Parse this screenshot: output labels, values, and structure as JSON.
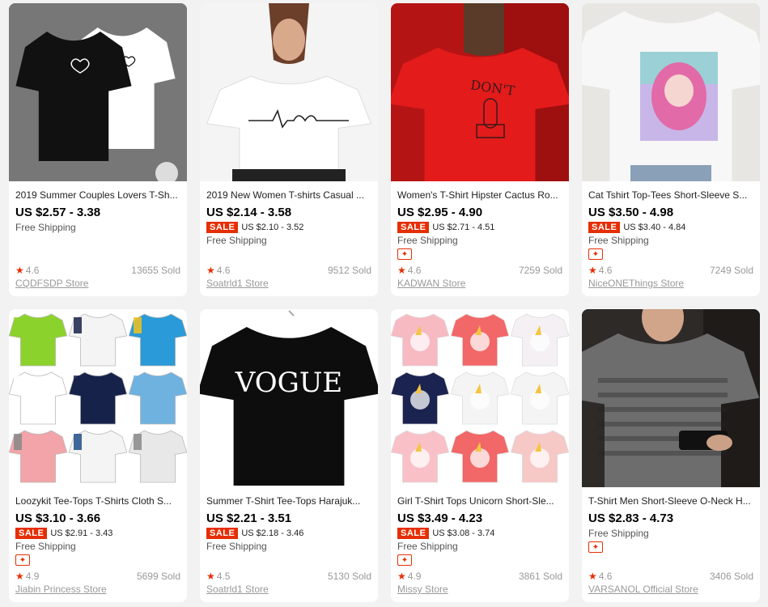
{
  "products": [
    {
      "title": "2019 Summer Couples Lovers T-Sh...",
      "price": "US $2.57 - 3.38",
      "sale": false,
      "sale_label": "",
      "sale_price": "",
      "shipping": "Free Shipping",
      "coupon": false,
      "rating": "4.6",
      "sold": "13655 Sold",
      "store": "CQDFSDP Store",
      "img": {
        "bg": "#6a6a6a",
        "shirt": "#111111",
        "shirt2": "#ffffff",
        "accent": "#ffffff",
        "kind": "couple"
      }
    },
    {
      "title": "2019 New Women T-shirts Casual ...",
      "price": "US $2.14 - 3.58",
      "sale": true,
      "sale_label": "SALE",
      "sale_price": "US $2.10 - 3.52",
      "shipping": "Free Shipping",
      "coupon": false,
      "rating": "4.6",
      "sold": "9512 Sold",
      "store": "Soatrld1 Store",
      "img": {
        "bg": "#f4f4f4",
        "shirt": "#ffffff",
        "accent": "#222222",
        "kind": "model-heartbeat"
      }
    },
    {
      "title": "Women's T-Shirt Hipster Cactus Ro...",
      "price": "US $2.95 - 4.90",
      "sale": true,
      "sale_label": "SALE",
      "sale_price": "US $2.71 - 4.51",
      "shipping": "Free Shipping",
      "coupon": true,
      "coupon_icon": "coupon-icon",
      "rating": "4.6",
      "sold": "7259 Sold",
      "store": "KADWAN Store",
      "img": {
        "bg": "#b51414",
        "shirt": "#e31b1b",
        "accent": "#3a1a1a",
        "kind": "model-cactus"
      }
    },
    {
      "title": "Cat Tshirt Top-Tees Short-Sleeve S...",
      "price": "US $3.50 - 4.98",
      "sale": true,
      "sale_label": "SALE",
      "sale_price": "US $3.40 - 4.84",
      "shipping": "Free Shipping",
      "coupon": true,
      "coupon_icon": "coupon-icon",
      "rating": "4.6",
      "sold": "7249 Sold",
      "store": "NiceONEThings Store",
      "img": {
        "bg": "#e8e6e2",
        "shirt": "#f7f7f7",
        "accent": "#e26aa8",
        "kind": "anime"
      }
    },
    {
      "title": "Loozykit Tee-Tops T-Shirts Cloth S...",
      "price": "US $3.10 - 3.66",
      "sale": true,
      "sale_label": "SALE",
      "sale_price": "US $2.91 - 3.43",
      "shipping": "Free Shipping",
      "coupon": true,
      "coupon_icon": "coupon-icon",
      "rating": "4.9",
      "sold": "5699 Sold",
      "store": "Jiabin Princess Store",
      "img": {
        "bg": "#ffffff",
        "kind": "kids-grid"
      }
    },
    {
      "title": "Summer T-Shirt Tee-Tops Harajuk...",
      "price": "US $2.21 - 3.51",
      "sale": true,
      "sale_label": "SALE",
      "sale_price": "US $2.18 - 3.46",
      "shipping": "Free Shipping",
      "coupon": false,
      "rating": "4.5",
      "sold": "5130 Sold",
      "store": "Soatrld1 Store",
      "img": {
        "bg": "#ffffff",
        "shirt": "#0d0d0d",
        "accent": "#ffffff",
        "kind": "vogue",
        "print": "VOGUE"
      }
    },
    {
      "title": "Girl T-Shirt Tops Unicorn Short-Sle...",
      "price": "US $3.49 - 4.23",
      "sale": true,
      "sale_label": "SALE",
      "sale_price": "US $3.08 - 3.74",
      "shipping": "Free Shipping",
      "coupon": true,
      "coupon_icon": "coupon-icon",
      "rating": "4.9",
      "sold": "3861 Sold",
      "store": "Missy Store",
      "img": {
        "bg": "#ffffff",
        "kind": "unicorn-grid"
      }
    },
    {
      "title": "T-Shirt Men Short-Sleeve O-Neck H...",
      "price": "US $2.83 - 4.73",
      "sale": false,
      "sale_label": "",
      "sale_price": "",
      "shipping": "Free Shipping",
      "coupon": true,
      "coupon_icon": "coupon-icon",
      "rating": "4.6",
      "sold": "3406 Sold",
      "store": "VARSANOL Official Store",
      "img": {
        "bg": "#3a3330",
        "shirt": "#6d6d6d",
        "accent": "#222222",
        "kind": "model-men"
      }
    }
  ],
  "colors": {
    "accent": "#e62e04",
    "page_bg": "#f2f2f2",
    "card_bg": "#ffffff"
  }
}
